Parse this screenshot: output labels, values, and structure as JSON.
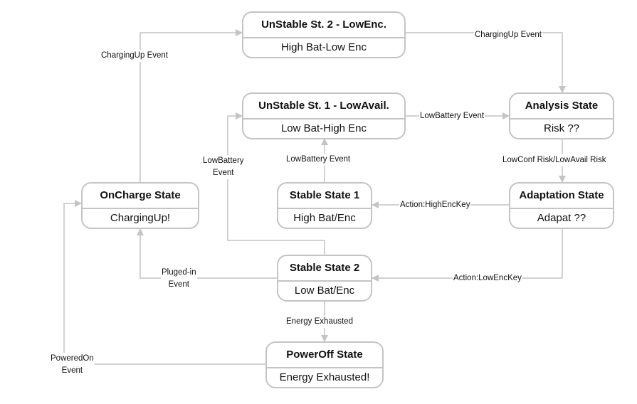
{
  "diagram": {
    "type": "state-machine",
    "edge_color": "#c4c4c4",
    "states": {
      "unstable2": {
        "title": "UnStable St. 2 - LowEnc.",
        "body": "High Bat-Low Enc"
      },
      "unstable1": {
        "title": "UnStable St. 1 - LowAvail.",
        "body": "Low Bat-High Enc"
      },
      "analysis": {
        "title": "Analysis State",
        "body": "Risk ??"
      },
      "oncharge": {
        "title": "OnCharge State",
        "body": "ChargingUp!"
      },
      "stable1": {
        "title": "Stable State 1",
        "body": "High Bat/Enc"
      },
      "adaptation": {
        "title": "Adaptation State",
        "body": "Adapat ??"
      },
      "stable2": {
        "title": "Stable State 2",
        "body": "Low Bat/Enc"
      },
      "poweroff": {
        "title": "PowerOff State",
        "body": "Energy Exhausted!"
      }
    },
    "transitions": [
      {
        "from": "oncharge",
        "to": "unstable2",
        "label": "ChargingUp Event"
      },
      {
        "from": "unstable2",
        "to": "analysis",
        "label": "ChargingUp Event"
      },
      {
        "from": "unstable1",
        "to": "analysis",
        "label": "LowBattery Event"
      },
      {
        "from": "stable1",
        "to": "unstable1",
        "label": "LowBattery Event"
      },
      {
        "from": "stable2",
        "to": "unstable1",
        "label": "LowBattery Event"
      },
      {
        "from": "analysis",
        "to": "adaptation",
        "label": "LowConf Risk/LowAvail Risk"
      },
      {
        "from": "adaptation",
        "to": "stable1",
        "label": "Action:HighEncKey"
      },
      {
        "from": "adaptation",
        "to": "stable2",
        "label": "Action:LowEncKey"
      },
      {
        "from": "stable2",
        "to": "oncharge",
        "label": "Pluged-in Event"
      },
      {
        "from": "stable2",
        "to": "poweroff",
        "label": "Energy Exhausted"
      },
      {
        "from": "poweroff",
        "to": "oncharge",
        "label": "PoweredOn Event"
      }
    ]
  },
  "labels": {
    "charging_up_left_1": "ChargingUp Event",
    "charging_up_top": "ChargingUp Event",
    "low_battery_right": "LowBattery Event",
    "low_battery_mid": "LowBattery Event",
    "low_battery_left_line1": "LowBattery",
    "low_battery_left_line2": "Event",
    "lowconf_risk": "LowConf Risk/LowAvail Risk",
    "action_high": "Action:HighEncKey",
    "action_low": "Action:LowEncKey",
    "pluged_line1": "Pluged-in",
    "pluged_line2": "Event",
    "energy_exhausted": "Energy Exhausted",
    "powered_line1": "PoweredOn",
    "powered_line2": "Event"
  }
}
